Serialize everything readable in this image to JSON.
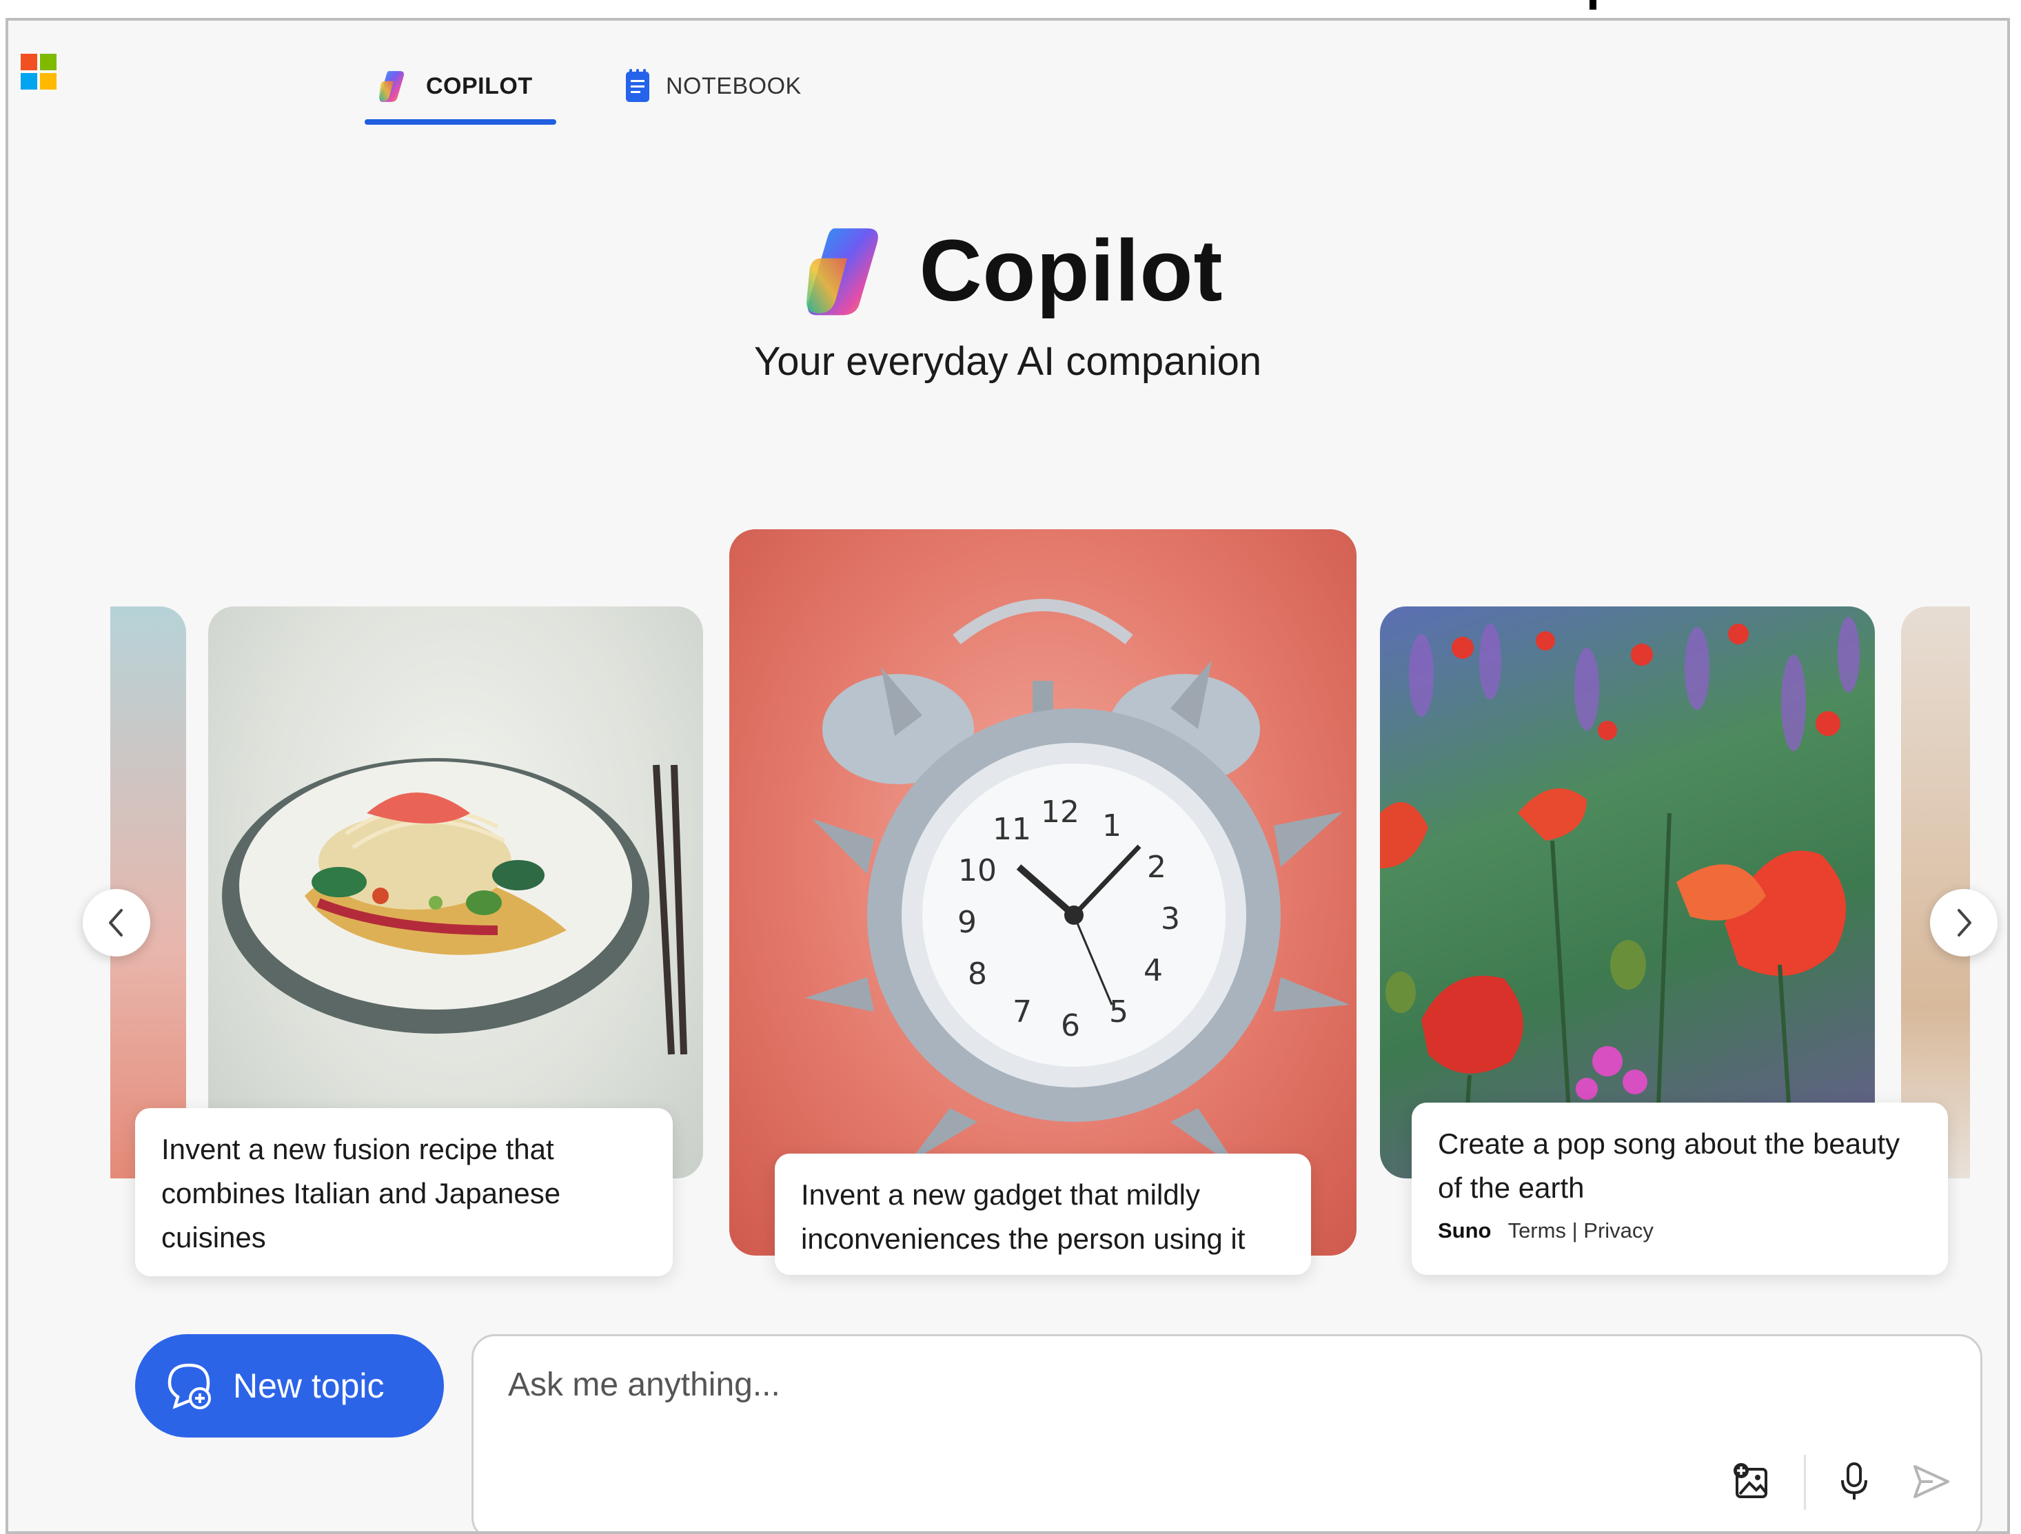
{
  "app": {
    "colors": {
      "accent": "#2c64e8",
      "tab_underline": "#1f5fe0",
      "win_red": "#f25022",
      "win_green": "#7fba00",
      "win_blue": "#00a4ef",
      "win_yellow": "#ffb900"
    }
  },
  "tabs": [
    {
      "label": "COPILOT",
      "icon": "copilot-logo-icon",
      "active": true
    },
    {
      "label": "NOTEBOOK",
      "icon": "notebook-icon",
      "active": false
    }
  ],
  "hero": {
    "title": "Copilot",
    "subtitle": "Your everyday AI companion"
  },
  "carousel": {
    "cards": [
      {
        "id": "food",
        "image": "fusion-dish-image",
        "prompt": "Invent a new fusion recipe that combines Italian and Japanese cuisines"
      },
      {
        "id": "clock",
        "image": "spiky-alarm-clock-image",
        "prompt": "Invent a new gadget that mildly inconveniences the person using it"
      },
      {
        "id": "flowers",
        "image": "poppy-field-image",
        "prompt": "Create a pop song about the beauty of the earth",
        "provider": "Suno",
        "terms": "Terms",
        "separator": "|",
        "privacy": "Privacy"
      }
    ],
    "prev_icon": "chevron-left-icon",
    "next_icon": "chevron-right-icon"
  },
  "composer": {
    "new_topic_label": "New topic",
    "new_topic_icon": "chat-plus-icon",
    "placeholder": "Ask me anything...",
    "icons": [
      "add-image-icon",
      "microphone-icon",
      "send-icon"
    ]
  }
}
